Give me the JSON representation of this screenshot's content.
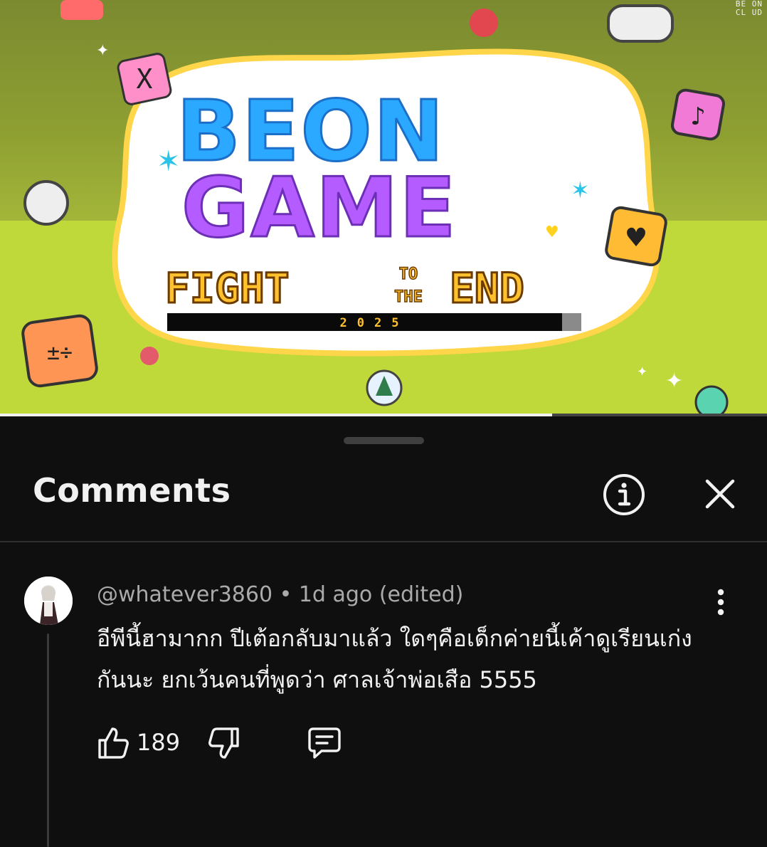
{
  "video": {
    "title_logo": {
      "line1": "BEON",
      "line2": "GAME",
      "subtitle_left": "FIGHT",
      "subtitle_to": "TO",
      "subtitle_the": "THE",
      "subtitle_right": "END",
      "year": "2025"
    },
    "watermark": [
      "BE ON",
      "CL UD"
    ],
    "progress_fraction": 0.72
  },
  "comments_panel": {
    "title": "Comments",
    "info_icon": "info-circle-icon",
    "close_icon": "close-icon"
  },
  "comment": {
    "author": "@whatever3860",
    "time": "1d ago (edited)",
    "separator": "•",
    "text": "อีพีนี้ฮามากก ปีเต้อกลับมาแล้ว ใดๆคือเด็กค่ายนี้เค้าดูเรียนเก่งกันนะ ยกเว้นคนที่พูดว่า ศาลเจ้าพ่อเสือ 5555",
    "like_count": "189",
    "colors": {
      "meta": "#aaaaaa",
      "text": "#f1f1f1"
    }
  }
}
